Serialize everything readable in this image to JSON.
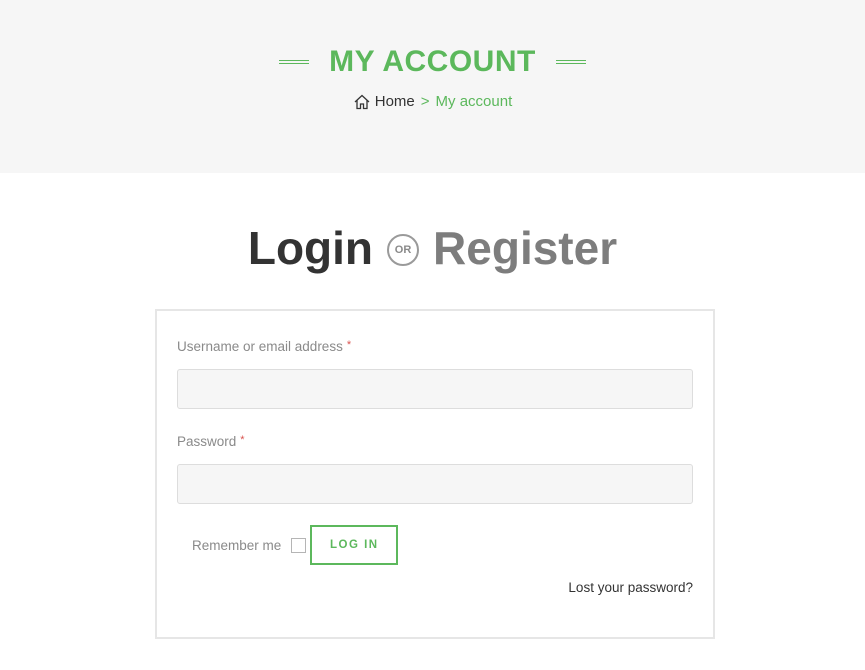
{
  "banner": {
    "title": "MY ACCOUNT",
    "breadcrumb": {
      "home_icon": "home-icon",
      "home_label": "Home",
      "separator": ">",
      "current": "My account"
    }
  },
  "auth": {
    "login_tab": "Login",
    "or_label": "OR",
    "register_tab": "Register"
  },
  "form": {
    "username_label": "Username or email address",
    "username_required": "*",
    "username_value": "",
    "password_label": "Password",
    "password_required": "*",
    "password_value": "",
    "remember_label": "Remember me",
    "remember_checked": false,
    "login_button": "LOG IN",
    "lost_password": "Lost your password?"
  },
  "colors": {
    "accent": "#5cb85c",
    "banner_bg": "#f6f6f6",
    "text_dark": "#333333",
    "text_muted": "#8a8a8a"
  }
}
